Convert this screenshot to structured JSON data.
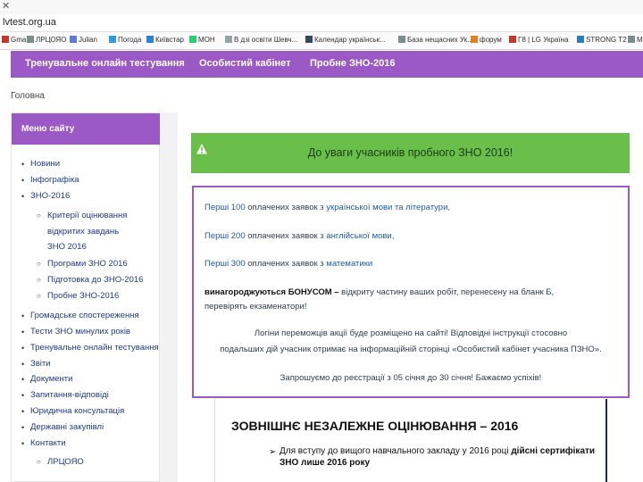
{
  "browser": {
    "close_glyph": "✕",
    "address": "lvtest.org.ua",
    "bookmarks": [
      {
        "label": "Gma",
        "color": "#c0392b"
      },
      {
        "label": "ЛРЦОЯО",
        "color": "#7f8c8d"
      },
      {
        "label": "Julian",
        "color": "#5b7bd5"
      },
      {
        "label": "Погода",
        "color": "#3498db"
      },
      {
        "label": "Київстар",
        "color": "#2c83d6"
      },
      {
        "label": "МОН",
        "color": "#2ecc71"
      },
      {
        "label": "В дзі освіти Шевч...",
        "color": "#95a5a6"
      },
      {
        "label": "Календар українськ...",
        "color": "#34495e"
      },
      {
        "label": "База нещасних Ук...",
        "color": "#7f8c8d"
      },
      {
        "label": "форум",
        "color": "#e67e22"
      },
      {
        "label": "Г8 | LG Україна",
        "color": "#c0392b"
      },
      {
        "label": "STRONG T2",
        "color": "#2980b9"
      },
      {
        "label": "Ми",
        "color": "#7f8c8d"
      }
    ]
  },
  "nav": {
    "items": [
      "Тренувальне онлайн тестування",
      "Особистий кабінет",
      "Пробне ЗНО-2016"
    ]
  },
  "breadcrumb": "Головна",
  "sidebar": {
    "title": "Меню сайту",
    "items": [
      "Новини",
      "Інфографіка",
      "ЗНО-2016",
      "Критерії оцінювання",
      "відкритих завдань",
      "ЗНО 2016",
      "Програми ЗНО 2016",
      "Підготовка до ЗНО-2016",
      "Пробне ЗНО-2016",
      "Громадське спостереження",
      "Тести ЗНО минулих років",
      "Тренувальне онлайн тестування",
      "Звіти",
      "Документи",
      "Запитання-відповіді",
      "Юридична консультація",
      "Державні закупівлі",
      "Контакти",
      "ЛРЦОЯО"
    ]
  },
  "alert": {
    "icon": "warning-icon",
    "text": "До уваги учасників пробного ЗНО 2016!"
  },
  "infobox": {
    "line1_a": "Перші 100",
    "line1_b": " оплачених заявок ",
    "line1_c": "з української мови та літератури,",
    "line2_a": "Перші 200",
    "line2_b": " оплачених заявок ",
    "line2_c": "з англійської мови,",
    "line3_a": "Перші 300",
    "line3_b": " оплачених заявок ",
    "line3_c": "з математики",
    "line4_a": "винагороджуються БОНУСОМ –",
    "line4_b": " відкриту частину ваших робіт, перенесену на бланк Б,",
    "line5": "перевірять екзаменатори!",
    "line6": "Логіни переможців акції буде розміщено на сайті! Відповідні інструкції стосовно",
    "line7": "подальших дій учасник отримає на інформаційній сторінці «Особистий кабінет учасника ПЗНО».",
    "line8": "Запрошуємо до реєстрації з 05 січня до 30 січня! Бажаємо успіхів!"
  },
  "slide": {
    "title": "ЗОВНІШНЄ НЕЗАЛЕЖНЕ ОЦІНЮВАННЯ – 2016",
    "arrow": "➢",
    "text_a": "Для вступу до вищого навчального закладу у 2016 році ",
    "text_b": "дійсні сертифікати",
    "text_c": "ЗНО лише 2016 року"
  }
}
